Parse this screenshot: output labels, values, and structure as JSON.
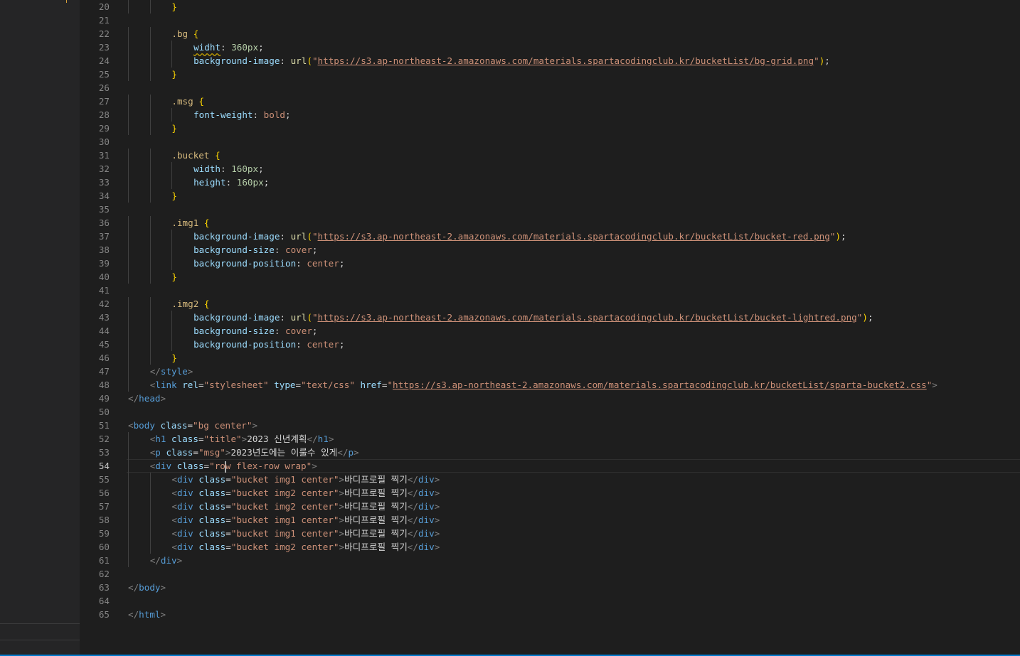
{
  "editor": {
    "current_line": 54,
    "lines": [
      {
        "n": "20",
        "indent": 2,
        "html": "<span class=\"br\">}</span>"
      },
      {
        "n": "21",
        "indent": 0,
        "html": ""
      },
      {
        "n": "22",
        "indent": 2,
        "html": "<span class=\"sel\">.bg</span> <span class=\"br\">{</span>"
      },
      {
        "n": "23",
        "indent": 3,
        "html": "<span class=\"prop squig\">widht</span><span class=\"p\">: </span><span class=\"num\">360px</span><span class=\"p\">;</span>"
      },
      {
        "n": "24",
        "indent": 3,
        "html": "<span class=\"prop\">background-image</span><span class=\"p\">: </span><span class=\"fn\">url</span><span class=\"br\">(</span><span class=\"val\">\"</span><span class=\"url\">https://s3.ap-northeast-2.amazonaws.com/materials.spartacodingclub.kr/bucketList/bg-grid.png</span><span class=\"val\">\"</span><span class=\"br\">)</span><span class=\"p\">;</span>"
      },
      {
        "n": "25",
        "indent": 2,
        "html": "<span class=\"br\">}</span>"
      },
      {
        "n": "26",
        "indent": 0,
        "html": ""
      },
      {
        "n": "27",
        "indent": 2,
        "html": "<span class=\"sel\">.msg</span> <span class=\"br\">{</span>"
      },
      {
        "n": "28",
        "indent": 3,
        "html": "<span class=\"prop\">font-weight</span><span class=\"p\">: </span><span class=\"val\">bold</span><span class=\"p\">;</span>"
      },
      {
        "n": "29",
        "indent": 2,
        "html": "<span class=\"br\">}</span>"
      },
      {
        "n": "30",
        "indent": 0,
        "html": ""
      },
      {
        "n": "31",
        "indent": 2,
        "html": "<span class=\"sel\">.bucket</span> <span class=\"br\">{</span>"
      },
      {
        "n": "32",
        "indent": 3,
        "html": "<span class=\"prop\">width</span><span class=\"p\">: </span><span class=\"num\">160px</span><span class=\"p\">;</span>"
      },
      {
        "n": "33",
        "indent": 3,
        "html": "<span class=\"prop\">height</span><span class=\"p\">: </span><span class=\"num\">160px</span><span class=\"p\">;</span>"
      },
      {
        "n": "34",
        "indent": 2,
        "html": "<span class=\"br\">}</span>"
      },
      {
        "n": "35",
        "indent": 0,
        "html": ""
      },
      {
        "n": "36",
        "indent": 2,
        "html": "<span class=\"sel\">.img1</span> <span class=\"br\">{</span>"
      },
      {
        "n": "37",
        "indent": 3,
        "html": "<span class=\"prop\">background-image</span><span class=\"p\">: </span><span class=\"fn\">url</span><span class=\"br\">(</span><span class=\"val\">\"</span><span class=\"url\">https://s3.ap-northeast-2.amazonaws.com/materials.spartacodingclub.kr/bucketList/bucket-red.png</span><span class=\"val\">\"</span><span class=\"br\">)</span><span class=\"p\">;</span>"
      },
      {
        "n": "38",
        "indent": 3,
        "html": "<span class=\"prop\">background-size</span><span class=\"p\">: </span><span class=\"val\">cover</span><span class=\"p\">;</span>"
      },
      {
        "n": "39",
        "indent": 3,
        "html": "<span class=\"prop\">background-position</span><span class=\"p\">: </span><span class=\"val\">center</span><span class=\"p\">;</span>"
      },
      {
        "n": "40",
        "indent": 2,
        "html": "<span class=\"br\">}</span>"
      },
      {
        "n": "41",
        "indent": 0,
        "html": ""
      },
      {
        "n": "42",
        "indent": 2,
        "html": "<span class=\"sel\">.img2</span> <span class=\"br\">{</span>"
      },
      {
        "n": "43",
        "indent": 3,
        "html": "<span class=\"prop\">background-image</span><span class=\"p\">: </span><span class=\"fn\">url</span><span class=\"br\">(</span><span class=\"val\">\"</span><span class=\"url\">https://s3.ap-northeast-2.amazonaws.com/materials.spartacodingclub.kr/bucketList/bucket-lightred.png</span><span class=\"val\">\"</span><span class=\"br\">)</span><span class=\"p\">;</span>"
      },
      {
        "n": "44",
        "indent": 3,
        "html": "<span class=\"prop\">background-size</span><span class=\"p\">: </span><span class=\"val\">cover</span><span class=\"p\">;</span>"
      },
      {
        "n": "45",
        "indent": 3,
        "html": "<span class=\"prop\">background-position</span><span class=\"p\">: </span><span class=\"val\">center</span><span class=\"p\">;</span>"
      },
      {
        "n": "46",
        "indent": 2,
        "html": "<span class=\"br\">}</span>"
      },
      {
        "n": "47",
        "indent": 1,
        "html": "<span class=\"tag\">&lt;/</span><span class=\"tn\">style</span><span class=\"tag\">&gt;</span>"
      },
      {
        "n": "48",
        "indent": 1,
        "html": "<span class=\"tag\">&lt;</span><span class=\"tn\">link</span> <span class=\"an\">rel</span><span class=\"p\">=</span><span class=\"av\">\"stylesheet\"</span> <span class=\"an\">type</span><span class=\"p\">=</span><span class=\"av\">\"text/css\"</span> <span class=\"an\">href</span><span class=\"p\">=</span><span class=\"av\">\"</span><span class=\"url\">https://s3.ap-northeast-2.amazonaws.com/materials.spartacodingclub.kr/bucketList/sparta-bucket2.css</span><span class=\"av\">\"</span><span class=\"tag\">&gt;</span>"
      },
      {
        "n": "49",
        "indent": 0,
        "html": "<span class=\"tag\">&lt;/</span><span class=\"tn\">head</span><span class=\"tag\">&gt;</span>"
      },
      {
        "n": "50",
        "indent": 0,
        "html": ""
      },
      {
        "n": "51",
        "indent": 0,
        "html": "<span class=\"tag\">&lt;</span><span class=\"tn\">body</span> <span class=\"an\">class</span><span class=\"p\">=</span><span class=\"av\">\"bg center\"</span><span class=\"tag\">&gt;</span>"
      },
      {
        "n": "52",
        "indent": 1,
        "html": "<span class=\"tag\">&lt;</span><span class=\"tn\">h1</span> <span class=\"an\">class</span><span class=\"p\">=</span><span class=\"av\">\"title\"</span><span class=\"tag\">&gt;</span><span class=\"txt\">2023 신년계획</span><span class=\"tag\">&lt;/</span><span class=\"tn\">h1</span><span class=\"tag\">&gt;</span>"
      },
      {
        "n": "53",
        "indent": 1,
        "html": "<span class=\"tag\">&lt;</span><span class=\"tn\">p</span> <span class=\"an\">class</span><span class=\"p\">=</span><span class=\"av\">\"msg\"</span><span class=\"tag\">&gt;</span><span class=\"txt\">2023년도에는 이룰수 있게</span><span class=\"tag\">&lt;/</span><span class=\"tn\">p</span><span class=\"tag\">&gt;</span>"
      },
      {
        "n": "54",
        "indent": 1,
        "html": "<span class=\"tag\">&lt;</span><span class=\"tn\">div</span> <span class=\"an\">class</span><span class=\"p\">=</span><span class=\"av\">\"ro<span class=\"cursor\"></span>w flex-row wrap\"</span><span class=\"tag\">&gt;</span>"
      },
      {
        "n": "55",
        "indent": 2,
        "html": "<span class=\"tag\">&lt;</span><span class=\"tn\">div</span> <span class=\"an\">class</span><span class=\"p\">=</span><span class=\"av\">\"bucket img1 center\"</span><span class=\"tag\">&gt;</span><span class=\"txt\">바디프로필 찍기</span><span class=\"tag\">&lt;/</span><span class=\"tn\">div</span><span class=\"tag\">&gt;</span>"
      },
      {
        "n": "56",
        "indent": 2,
        "html": "<span class=\"tag\">&lt;</span><span class=\"tn\">div</span> <span class=\"an\">class</span><span class=\"p\">=</span><span class=\"av\">\"bucket img2 center\"</span><span class=\"tag\">&gt;</span><span class=\"txt\">바디프로필 찍기</span><span class=\"tag\">&lt;/</span><span class=\"tn\">div</span><span class=\"tag\">&gt;</span>"
      },
      {
        "n": "57",
        "indent": 2,
        "html": "<span class=\"tag\">&lt;</span><span class=\"tn\">div</span> <span class=\"an\">class</span><span class=\"p\">=</span><span class=\"av\">\"bucket img2 center\"</span><span class=\"tag\">&gt;</span><span class=\"txt\">바디프로필 찍기</span><span class=\"tag\">&lt;/</span><span class=\"tn\">div</span><span class=\"tag\">&gt;</span>"
      },
      {
        "n": "58",
        "indent": 2,
        "html": "<span class=\"tag\">&lt;</span><span class=\"tn\">div</span> <span class=\"an\">class</span><span class=\"p\">=</span><span class=\"av\">\"bucket img1 center\"</span><span class=\"tag\">&gt;</span><span class=\"txt\">바디프로필 찍기</span><span class=\"tag\">&lt;/</span><span class=\"tn\">div</span><span class=\"tag\">&gt;</span>"
      },
      {
        "n": "59",
        "indent": 2,
        "html": "<span class=\"tag\">&lt;</span><span class=\"tn\">div</span> <span class=\"an\">class</span><span class=\"p\">=</span><span class=\"av\">\"bucket img1 center\"</span><span class=\"tag\">&gt;</span><span class=\"txt\">바디프로필 찍기</span><span class=\"tag\">&lt;/</span><span class=\"tn\">div</span><span class=\"tag\">&gt;</span>"
      },
      {
        "n": "60",
        "indent": 2,
        "html": "<span class=\"tag\">&lt;</span><span class=\"tn\">div</span> <span class=\"an\">class</span><span class=\"p\">=</span><span class=\"av\">\"bucket img2 center\"</span><span class=\"tag\">&gt;</span><span class=\"txt\">바디프로필 찍기</span><span class=\"tag\">&lt;/</span><span class=\"tn\">div</span><span class=\"tag\">&gt;</span>"
      },
      {
        "n": "61",
        "indent": 1,
        "html": "<span class=\"tag\">&lt;/</span><span class=\"tn\">div</span><span class=\"tag\">&gt;</span>"
      },
      {
        "n": "62",
        "indent": 0,
        "html": ""
      },
      {
        "n": "63",
        "indent": 0,
        "html": "<span class=\"tag\">&lt;/</span><span class=\"tn\">body</span><span class=\"tag\">&gt;</span>"
      },
      {
        "n": "64",
        "indent": 0,
        "html": ""
      },
      {
        "n": "65",
        "indent": 0,
        "html": "<span class=\"tag\">&lt;/</span><span class=\"tn\">html</span><span class=\"tag\">&gt;</span>"
      }
    ]
  }
}
